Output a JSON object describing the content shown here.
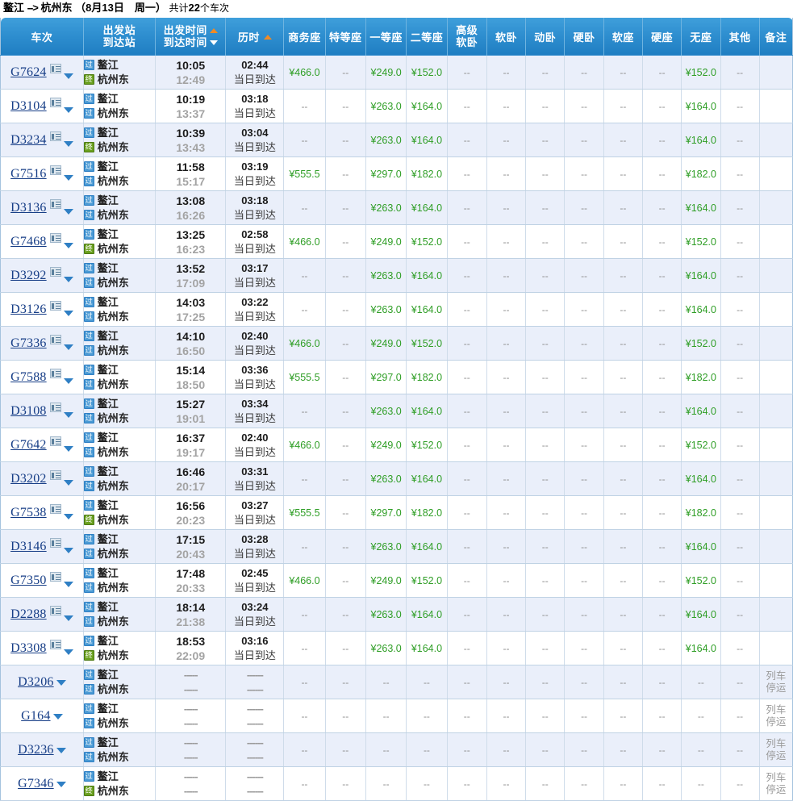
{
  "page": {
    "title_from": "鳌江",
    "title_arrow": "-->",
    "title_to": "杭州东",
    "title_date": "（8月13日　周一）",
    "title_count_prefix": "共计",
    "title_count": "22",
    "title_count_suffix": "个车次"
  },
  "colors": {
    "header_blue": "#2f8fd0",
    "price_green": "#2f9e26",
    "link_blue": "#163d86",
    "sort_active": "#f08a24",
    "row_alt": "#eaeffa"
  },
  "header": {
    "code": "车次",
    "station_from": "出发站",
    "station_to": "到达站",
    "time_dep": "出发时间",
    "time_arr": "到达时间",
    "duration": "历时",
    "business": "商务座",
    "special": "特等座",
    "first": "一等座",
    "second": "二等座",
    "senior_soft_sleeper_1": "高级",
    "senior_soft_sleeper_2": "软卧",
    "soft_sleeper": "软卧",
    "emu_sleeper": "动卧",
    "hard_sleeper": "硬卧",
    "soft_seat": "软座",
    "hard_seat": "硬座",
    "no_seat": "无座",
    "other": "其他",
    "remark": "备注"
  },
  "icons": {
    "pass": "过",
    "end": "终",
    "card": "train-info-card-icon",
    "caret": "chevron-down-icon",
    "sort_up": "sort-ascending-icon",
    "sort_down": "sort-descending-icon"
  },
  "labels": {
    "same_day": "当日到达",
    "nil": "--",
    "time_blank": "-----",
    "dur_blank": "------",
    "suspended_line1": "列车",
    "suspended_line2": "停运"
  },
  "rows": [
    {
      "code": "G7624",
      "has_card": true,
      "from_icon": "过",
      "from": "鳌江",
      "to_icon": "终",
      "to": "杭州东",
      "dep": "10:05",
      "arr": "12:49",
      "dur": "02:44",
      "note": "当日到达",
      "business": "¥466.0",
      "special": "--",
      "first": "¥249.0",
      "second": "¥152.0",
      "senior_soft": "--",
      "soft_sleeper": "--",
      "emu_sleeper": "--",
      "hard_sleeper": "--",
      "soft_seat": "--",
      "hard_seat": "--",
      "no_seat": "¥152.0",
      "other": "--",
      "remark": ""
    },
    {
      "code": "D3104",
      "has_card": true,
      "from_icon": "过",
      "from": "鳌江",
      "to_icon": "过",
      "to": "杭州东",
      "dep": "10:19",
      "arr": "13:37",
      "dur": "03:18",
      "note": "当日到达",
      "business": "--",
      "special": "--",
      "first": "¥263.0",
      "second": "¥164.0",
      "senior_soft": "--",
      "soft_sleeper": "--",
      "emu_sleeper": "--",
      "hard_sleeper": "--",
      "soft_seat": "--",
      "hard_seat": "--",
      "no_seat": "¥164.0",
      "other": "--",
      "remark": ""
    },
    {
      "code": "D3234",
      "has_card": true,
      "from_icon": "过",
      "from": "鳌江",
      "to_icon": "终",
      "to": "杭州东",
      "dep": "10:39",
      "arr": "13:43",
      "dur": "03:04",
      "note": "当日到达",
      "business": "--",
      "special": "--",
      "first": "¥263.0",
      "second": "¥164.0",
      "senior_soft": "--",
      "soft_sleeper": "--",
      "emu_sleeper": "--",
      "hard_sleeper": "--",
      "soft_seat": "--",
      "hard_seat": "--",
      "no_seat": "¥164.0",
      "other": "--",
      "remark": ""
    },
    {
      "code": "G7516",
      "has_card": true,
      "from_icon": "过",
      "from": "鳌江",
      "to_icon": "过",
      "to": "杭州东",
      "dep": "11:58",
      "arr": "15:17",
      "dur": "03:19",
      "note": "当日到达",
      "business": "¥555.5",
      "special": "--",
      "first": "¥297.0",
      "second": "¥182.0",
      "senior_soft": "--",
      "soft_sleeper": "--",
      "emu_sleeper": "--",
      "hard_sleeper": "--",
      "soft_seat": "--",
      "hard_seat": "--",
      "no_seat": "¥182.0",
      "other": "--",
      "remark": ""
    },
    {
      "code": "D3136",
      "has_card": true,
      "from_icon": "过",
      "from": "鳌江",
      "to_icon": "过",
      "to": "杭州东",
      "dep": "13:08",
      "arr": "16:26",
      "dur": "03:18",
      "note": "当日到达",
      "business": "--",
      "special": "--",
      "first": "¥263.0",
      "second": "¥164.0",
      "senior_soft": "--",
      "soft_sleeper": "--",
      "emu_sleeper": "--",
      "hard_sleeper": "--",
      "soft_seat": "--",
      "hard_seat": "--",
      "no_seat": "¥164.0",
      "other": "--",
      "remark": ""
    },
    {
      "code": "G7468",
      "has_card": true,
      "from_icon": "过",
      "from": "鳌江",
      "to_icon": "终",
      "to": "杭州东",
      "dep": "13:25",
      "arr": "16:23",
      "dur": "02:58",
      "note": "当日到达",
      "business": "¥466.0",
      "special": "--",
      "first": "¥249.0",
      "second": "¥152.0",
      "senior_soft": "--",
      "soft_sleeper": "--",
      "emu_sleeper": "--",
      "hard_sleeper": "--",
      "soft_seat": "--",
      "hard_seat": "--",
      "no_seat": "¥152.0",
      "other": "--",
      "remark": ""
    },
    {
      "code": "D3292",
      "has_card": true,
      "from_icon": "过",
      "from": "鳌江",
      "to_icon": "过",
      "to": "杭州东",
      "dep": "13:52",
      "arr": "17:09",
      "dur": "03:17",
      "note": "当日到达",
      "business": "--",
      "special": "--",
      "first": "¥263.0",
      "second": "¥164.0",
      "senior_soft": "--",
      "soft_sleeper": "--",
      "emu_sleeper": "--",
      "hard_sleeper": "--",
      "soft_seat": "--",
      "hard_seat": "--",
      "no_seat": "¥164.0",
      "other": "--",
      "remark": ""
    },
    {
      "code": "D3126",
      "has_card": true,
      "from_icon": "过",
      "from": "鳌江",
      "to_icon": "过",
      "to": "杭州东",
      "dep": "14:03",
      "arr": "17:25",
      "dur": "03:22",
      "note": "当日到达",
      "business": "--",
      "special": "--",
      "first": "¥263.0",
      "second": "¥164.0",
      "senior_soft": "--",
      "soft_sleeper": "--",
      "emu_sleeper": "--",
      "hard_sleeper": "--",
      "soft_seat": "--",
      "hard_seat": "--",
      "no_seat": "¥164.0",
      "other": "--",
      "remark": ""
    },
    {
      "code": "G7336",
      "has_card": true,
      "from_icon": "过",
      "from": "鳌江",
      "to_icon": "过",
      "to": "杭州东",
      "dep": "14:10",
      "arr": "16:50",
      "dur": "02:40",
      "note": "当日到达",
      "business": "¥466.0",
      "special": "--",
      "first": "¥249.0",
      "second": "¥152.0",
      "senior_soft": "--",
      "soft_sleeper": "--",
      "emu_sleeper": "--",
      "hard_sleeper": "--",
      "soft_seat": "--",
      "hard_seat": "--",
      "no_seat": "¥152.0",
      "other": "--",
      "remark": ""
    },
    {
      "code": "G7588",
      "has_card": true,
      "from_icon": "过",
      "from": "鳌江",
      "to_icon": "过",
      "to": "杭州东",
      "dep": "15:14",
      "arr": "18:50",
      "dur": "03:36",
      "note": "当日到达",
      "business": "¥555.5",
      "special": "--",
      "first": "¥297.0",
      "second": "¥182.0",
      "senior_soft": "--",
      "soft_sleeper": "--",
      "emu_sleeper": "--",
      "hard_sleeper": "--",
      "soft_seat": "--",
      "hard_seat": "--",
      "no_seat": "¥182.0",
      "other": "--",
      "remark": ""
    },
    {
      "code": "D3108",
      "has_card": true,
      "from_icon": "过",
      "from": "鳌江",
      "to_icon": "过",
      "to": "杭州东",
      "dep": "15:27",
      "arr": "19:01",
      "dur": "03:34",
      "note": "当日到达",
      "business": "--",
      "special": "--",
      "first": "¥263.0",
      "second": "¥164.0",
      "senior_soft": "--",
      "soft_sleeper": "--",
      "emu_sleeper": "--",
      "hard_sleeper": "--",
      "soft_seat": "--",
      "hard_seat": "--",
      "no_seat": "¥164.0",
      "other": "--",
      "remark": ""
    },
    {
      "code": "G7642",
      "has_card": true,
      "from_icon": "过",
      "from": "鳌江",
      "to_icon": "过",
      "to": "杭州东",
      "dep": "16:37",
      "arr": "19:17",
      "dur": "02:40",
      "note": "当日到达",
      "business": "¥466.0",
      "special": "--",
      "first": "¥249.0",
      "second": "¥152.0",
      "senior_soft": "--",
      "soft_sleeper": "--",
      "emu_sleeper": "--",
      "hard_sleeper": "--",
      "soft_seat": "--",
      "hard_seat": "--",
      "no_seat": "¥152.0",
      "other": "--",
      "remark": ""
    },
    {
      "code": "D3202",
      "has_card": true,
      "from_icon": "过",
      "from": "鳌江",
      "to_icon": "过",
      "to": "杭州东",
      "dep": "16:46",
      "arr": "20:17",
      "dur": "03:31",
      "note": "当日到达",
      "business": "--",
      "special": "--",
      "first": "¥263.0",
      "second": "¥164.0",
      "senior_soft": "--",
      "soft_sleeper": "--",
      "emu_sleeper": "--",
      "hard_sleeper": "--",
      "soft_seat": "--",
      "hard_seat": "--",
      "no_seat": "¥164.0",
      "other": "--",
      "remark": ""
    },
    {
      "code": "G7538",
      "has_card": true,
      "from_icon": "过",
      "from": "鳌江",
      "to_icon": "终",
      "to": "杭州东",
      "dep": "16:56",
      "arr": "20:23",
      "dur": "03:27",
      "note": "当日到达",
      "business": "¥555.5",
      "special": "--",
      "first": "¥297.0",
      "second": "¥182.0",
      "senior_soft": "--",
      "soft_sleeper": "--",
      "emu_sleeper": "--",
      "hard_sleeper": "--",
      "soft_seat": "--",
      "hard_seat": "--",
      "no_seat": "¥182.0",
      "other": "--",
      "remark": ""
    },
    {
      "code": "D3146",
      "has_card": true,
      "from_icon": "过",
      "from": "鳌江",
      "to_icon": "过",
      "to": "杭州东",
      "dep": "17:15",
      "arr": "20:43",
      "dur": "03:28",
      "note": "当日到达",
      "business": "--",
      "special": "--",
      "first": "¥263.0",
      "second": "¥164.0",
      "senior_soft": "--",
      "soft_sleeper": "--",
      "emu_sleeper": "--",
      "hard_sleeper": "--",
      "soft_seat": "--",
      "hard_seat": "--",
      "no_seat": "¥164.0",
      "other": "--",
      "remark": ""
    },
    {
      "code": "G7350",
      "has_card": true,
      "from_icon": "过",
      "from": "鳌江",
      "to_icon": "过",
      "to": "杭州东",
      "dep": "17:48",
      "arr": "20:33",
      "dur": "02:45",
      "note": "当日到达",
      "business": "¥466.0",
      "special": "--",
      "first": "¥249.0",
      "second": "¥152.0",
      "senior_soft": "--",
      "soft_sleeper": "--",
      "emu_sleeper": "--",
      "hard_sleeper": "--",
      "soft_seat": "--",
      "hard_seat": "--",
      "no_seat": "¥152.0",
      "other": "--",
      "remark": ""
    },
    {
      "code": "D2288",
      "has_card": true,
      "from_icon": "过",
      "from": "鳌江",
      "to_icon": "过",
      "to": "杭州东",
      "dep": "18:14",
      "arr": "21:38",
      "dur": "03:24",
      "note": "当日到达",
      "business": "--",
      "special": "--",
      "first": "¥263.0",
      "second": "¥164.0",
      "senior_soft": "--",
      "soft_sleeper": "--",
      "emu_sleeper": "--",
      "hard_sleeper": "--",
      "soft_seat": "--",
      "hard_seat": "--",
      "no_seat": "¥164.0",
      "other": "--",
      "remark": ""
    },
    {
      "code": "D3308",
      "has_card": true,
      "from_icon": "过",
      "from": "鳌江",
      "to_icon": "终",
      "to": "杭州东",
      "dep": "18:53",
      "arr": "22:09",
      "dur": "03:16",
      "note": "当日到达",
      "business": "--",
      "special": "--",
      "first": "¥263.0",
      "second": "¥164.0",
      "senior_soft": "--",
      "soft_sleeper": "--",
      "emu_sleeper": "--",
      "hard_sleeper": "--",
      "soft_seat": "--",
      "hard_seat": "--",
      "no_seat": "¥164.0",
      "other": "--",
      "remark": ""
    },
    {
      "code": "D3206",
      "has_card": false,
      "suspended": true,
      "from_icon": "过",
      "from": "鳌江",
      "to_icon": "过",
      "to": "杭州东",
      "dep": "-----",
      "arr": "-----",
      "dur": "------",
      "note": "------",
      "business": "--",
      "special": "--",
      "first": "--",
      "second": "--",
      "senior_soft": "--",
      "soft_sleeper": "--",
      "emu_sleeper": "--",
      "hard_sleeper": "--",
      "soft_seat": "--",
      "hard_seat": "--",
      "no_seat": "--",
      "other": "--",
      "remark": "列车停运"
    },
    {
      "code": "G164",
      "has_card": false,
      "suspended": true,
      "from_icon": "过",
      "from": "鳌江",
      "to_icon": "过",
      "to": "杭州东",
      "dep": "-----",
      "arr": "-----",
      "dur": "------",
      "note": "------",
      "business": "--",
      "special": "--",
      "first": "--",
      "second": "--",
      "senior_soft": "--",
      "soft_sleeper": "--",
      "emu_sleeper": "--",
      "hard_sleeper": "--",
      "soft_seat": "--",
      "hard_seat": "--",
      "no_seat": "--",
      "other": "--",
      "remark": "列车停运"
    },
    {
      "code": "D3236",
      "has_card": false,
      "suspended": true,
      "from_icon": "过",
      "from": "鳌江",
      "to_icon": "过",
      "to": "杭州东",
      "dep": "-----",
      "arr": "-----",
      "dur": "------",
      "note": "------",
      "business": "--",
      "special": "--",
      "first": "--",
      "second": "--",
      "senior_soft": "--",
      "soft_sleeper": "--",
      "emu_sleeper": "--",
      "hard_sleeper": "--",
      "soft_seat": "--",
      "hard_seat": "--",
      "no_seat": "--",
      "other": "--",
      "remark": "列车停运"
    },
    {
      "code": "G7346",
      "has_card": false,
      "suspended": true,
      "from_icon": "过",
      "from": "鳌江",
      "to_icon": "终",
      "to": "杭州东",
      "dep": "-----",
      "arr": "-----",
      "dur": "------",
      "note": "------",
      "business": "--",
      "special": "--",
      "first": "--",
      "second": "--",
      "senior_soft": "--",
      "soft_sleeper": "--",
      "emu_sleeper": "--",
      "hard_sleeper": "--",
      "soft_seat": "--",
      "hard_seat": "--",
      "no_seat": "--",
      "other": "--",
      "remark": "列车停运"
    }
  ]
}
